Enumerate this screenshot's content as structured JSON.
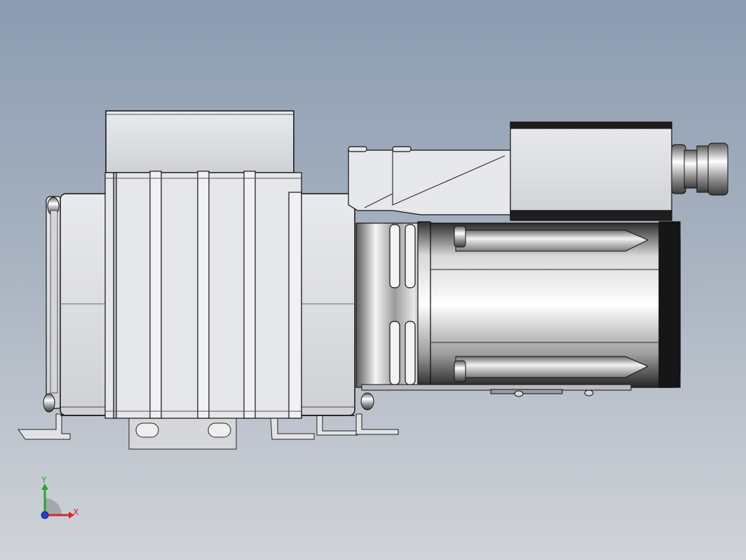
{
  "viewport": {
    "background_top": "#8c9cb1",
    "background_bottom": "#d0d3d8"
  },
  "model": {
    "description_icon": "motor-pump-assembly",
    "body_color": "#e4e6ea",
    "edge_color": "#1a1a1a"
  },
  "triad": {
    "x_label": "X",
    "y_label": "Y",
    "x_color": "#d12a2a",
    "y_color": "#2aa52a",
    "z_color": "#2a3fd1"
  }
}
